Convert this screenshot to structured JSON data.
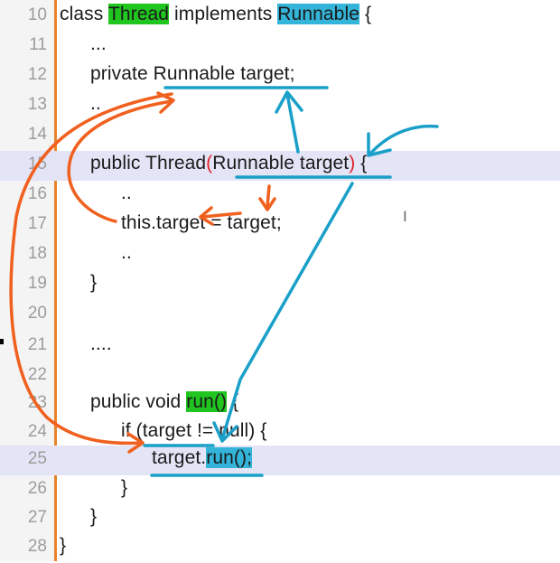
{
  "editor": {
    "lines": [
      {
        "num": "10",
        "pre": "class ",
        "tok1": "Thread",
        "mid": " implements ",
        "tok2": "Runnable",
        "post": " {"
      },
      {
        "num": "11",
        "text": "..."
      },
      {
        "num": "12",
        "text": "private Runnable target;"
      },
      {
        "num": "13",
        "text": ".."
      },
      {
        "num": "14",
        "text": ""
      },
      {
        "num": "15",
        "pre": "public Thread",
        "open": "(",
        "mid": "Runnable target",
        "close": ")",
        "post": " {"
      },
      {
        "num": "16",
        "text": ".."
      },
      {
        "num": "17",
        "text": "this.target = target;"
      },
      {
        "num": "18",
        "text": ".."
      },
      {
        "num": "19",
        "text": "}"
      },
      {
        "num": "20",
        "text": ""
      },
      {
        "num": "21",
        "text": "...."
      },
      {
        "num": "22",
        "text": ""
      },
      {
        "num": "23",
        "pre": "public void ",
        "tok": "run()",
        "post": " {"
      },
      {
        "num": "24",
        "text": "if (target != null) {"
      },
      {
        "num": "25",
        "pre": "target.",
        "tok": "run();",
        "post": ""
      },
      {
        "num": "26",
        "text": "}"
      },
      {
        "num": "27",
        "text": "}"
      },
      {
        "num": "28",
        "text": "}"
      }
    ],
    "cursor_glyph": "I"
  },
  "annotations": {
    "blue_color": "#1aa0c8",
    "orange_color": "#f0601e"
  }
}
